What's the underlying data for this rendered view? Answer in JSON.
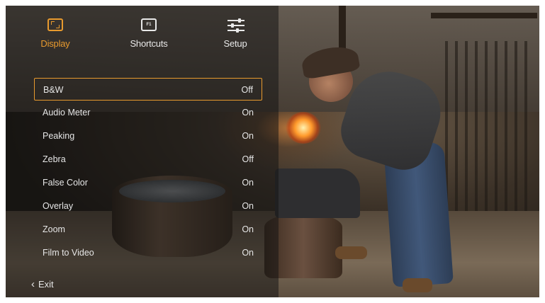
{
  "tabs": [
    {
      "label": "Display",
      "icon": "display-icon",
      "active": true
    },
    {
      "label": "Shortcuts",
      "icon": "shortcuts-icon",
      "icon_text": "F1",
      "active": false
    },
    {
      "label": "Setup",
      "icon": "setup-sliders-icon",
      "active": false
    }
  ],
  "settings": [
    {
      "name": "B&W",
      "value": "Off",
      "selected": true
    },
    {
      "name": "Audio Meter",
      "value": "On",
      "selected": false
    },
    {
      "name": "Peaking",
      "value": "On",
      "selected": false
    },
    {
      "name": "Zebra",
      "value": "Off",
      "selected": false
    },
    {
      "name": "False Color",
      "value": "On",
      "selected": false
    },
    {
      "name": "Overlay",
      "value": "On",
      "selected": false
    },
    {
      "name": "Zoom",
      "value": "On",
      "selected": false
    },
    {
      "name": "Film to Video",
      "value": "On",
      "selected": false
    }
  ],
  "exit": {
    "label": "Exit",
    "icon": "chevron-left-icon"
  },
  "colors": {
    "accent": "#e89a2e",
    "text": "#e6e6e6"
  }
}
